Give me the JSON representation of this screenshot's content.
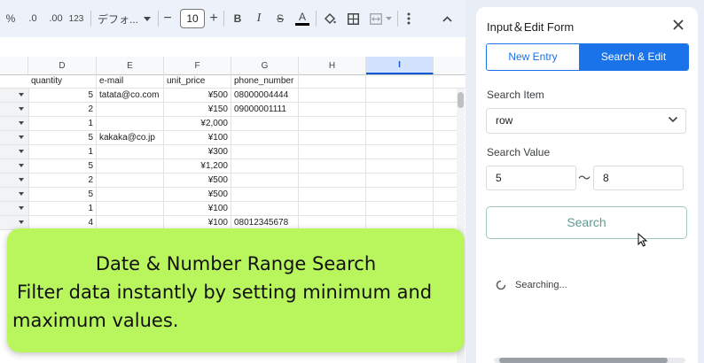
{
  "toolbar": {
    "percent": "%",
    "dec_decrease": ".0",
    "dec_increase": ".00",
    "number_format": "123",
    "font": "デフォ...",
    "font_size": "10",
    "minus": "−",
    "plus": "+",
    "bold": "B",
    "italic": "I",
    "strike": "S",
    "text_color": "A"
  },
  "sheet": {
    "columns": [
      "D",
      "E",
      "F",
      "G",
      "H",
      "I"
    ],
    "selected_column": "I",
    "headers": {
      "quantity": "quantity",
      "email": "e-mail",
      "price": "unit_price",
      "phone": "phone_number"
    },
    "rows": [
      {
        "quantity": "5",
        "email": "tatata@co.com",
        "price": "¥500",
        "phone": "08000004444"
      },
      {
        "quantity": "2",
        "email": "",
        "price": "¥150",
        "phone": "09000001111"
      },
      {
        "quantity": "1",
        "email": "",
        "price": "¥2,000",
        "phone": ""
      },
      {
        "quantity": "5",
        "email": "kakaka@co.jp",
        "price": "¥100",
        "phone": ""
      },
      {
        "quantity": "1",
        "email": "",
        "price": "¥300",
        "phone": ""
      },
      {
        "quantity": "5",
        "email": "",
        "price": "¥1,200",
        "phone": ""
      },
      {
        "quantity": "2",
        "email": "",
        "price": "¥500",
        "phone": ""
      },
      {
        "quantity": "5",
        "email": "",
        "price": "¥500",
        "phone": ""
      },
      {
        "quantity": "1",
        "email": "",
        "price": "¥100",
        "phone": ""
      },
      {
        "quantity": "4",
        "email": "",
        "price": "¥100",
        "phone": "08012345678"
      }
    ]
  },
  "banner": {
    "title": "Date & Number Range Search",
    "line2": "Filter data instantly by setting minimum and",
    "line3": "maximum values."
  },
  "panel": {
    "title": "Input＆Edit Form",
    "tab_new": "New Entry",
    "tab_search": "Search & Edit",
    "search_item_label": "Search Item",
    "search_item_value": "row",
    "search_value_label": "Search Value",
    "min_value": "5",
    "range_separator": "〜",
    "max_value": "8",
    "search_button": "Search",
    "status": "Searching..."
  },
  "colors": {
    "accent": "#1a73e8",
    "banner": "#b9f65e",
    "search_button_text": "#5f9c8d"
  }
}
